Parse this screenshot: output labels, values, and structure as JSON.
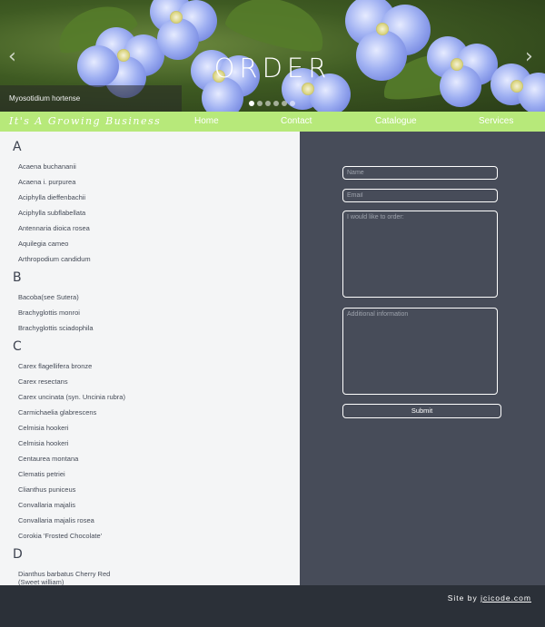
{
  "hero": {
    "title": "ORDER",
    "caption": "Myosotidium hortense",
    "prev_icon": "chevron-left-icon",
    "next_icon": "chevron-right-icon",
    "dot_count": 6,
    "active_dot": 1
  },
  "nav": {
    "logo": "It's A Growing Business",
    "links": [
      "Home",
      "Contact",
      "Catalogue",
      "Services"
    ],
    "color": "#b7e97a"
  },
  "plants": [
    {
      "letter": "A",
      "items": [
        "Acaena buchananii",
        "Acaena i. purpurea",
        "Aciphylla dieffenbachii",
        "Aciphylla subflabellata",
        "Antennaria dioica rosea",
        "Aquilegia cameo",
        "Arthropodium candidum"
      ]
    },
    {
      "letter": "B",
      "items": [
        "Bacoba(see Sutera)",
        "Brachyglottis monroi",
        "Brachyglottis sciadophila"
      ]
    },
    {
      "letter": "C",
      "items": [
        "Carex flagellifera bronze",
        "Carex resectans",
        "Carex uncinata (syn. Uncinia rubra)",
        "Carmichaelia glabrescens",
        "Celmisia hookeri",
        "Celmisia hookeri",
        "Centaurea montana",
        "Clematis petriei",
        "Clianthus puniceus",
        "Convallaria majalis",
        "Convallaria majalis rosea",
        "Corokia 'Frosted Chocolate'"
      ]
    },
    {
      "letter": "D",
      "items": [
        "Dianthus barbatus Cherry Red (Sweet william)"
      ]
    }
  ],
  "form": {
    "name_placeholder": "Name",
    "email_placeholder": "Email",
    "order_placeholder": "I would like to order:",
    "extra_placeholder": "Additional information",
    "submit_label": "Submit",
    "panel_color": "#474c59"
  },
  "footer": {
    "prefix": "Site by ",
    "link": "jcicode.com"
  }
}
